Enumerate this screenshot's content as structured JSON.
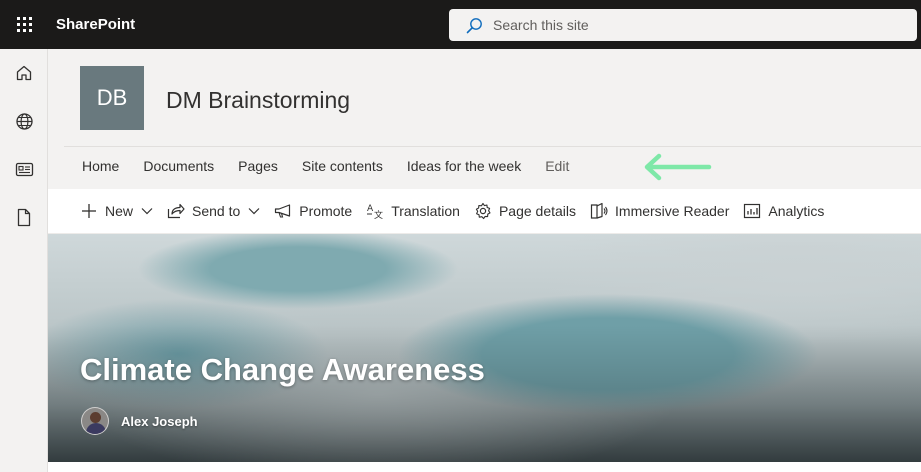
{
  "suitebar": {
    "app_name": "SharePoint",
    "waffle_icon": "app-launcher-icon",
    "search_placeholder": "Search this site",
    "search_icon": "search-icon",
    "background": "#1b1a19"
  },
  "appbar": {
    "items": [
      {
        "icon": "home-icon"
      },
      {
        "icon": "globe-icon"
      },
      {
        "icon": "news-icon"
      },
      {
        "icon": "file-icon"
      }
    ]
  },
  "site": {
    "logo_initials": "DB",
    "logo_color": "#69797e",
    "title": "DM Brainstorming",
    "nav": [
      "Home",
      "Documents",
      "Pages",
      "Site contents",
      "Ideas for the week",
      "Edit"
    ],
    "annotation_arrow_color": "#7ee8a8"
  },
  "commandbar": {
    "new_label": "New",
    "send_to_label": "Send to",
    "promote_label": "Promote",
    "translation_label": "Translation",
    "page_details_label": "Page details",
    "immersive_reader_label": "Immersive Reader",
    "analytics_label": "Analytics"
  },
  "hero": {
    "title": "Climate Change Awareness",
    "author": "Alex Joseph"
  }
}
